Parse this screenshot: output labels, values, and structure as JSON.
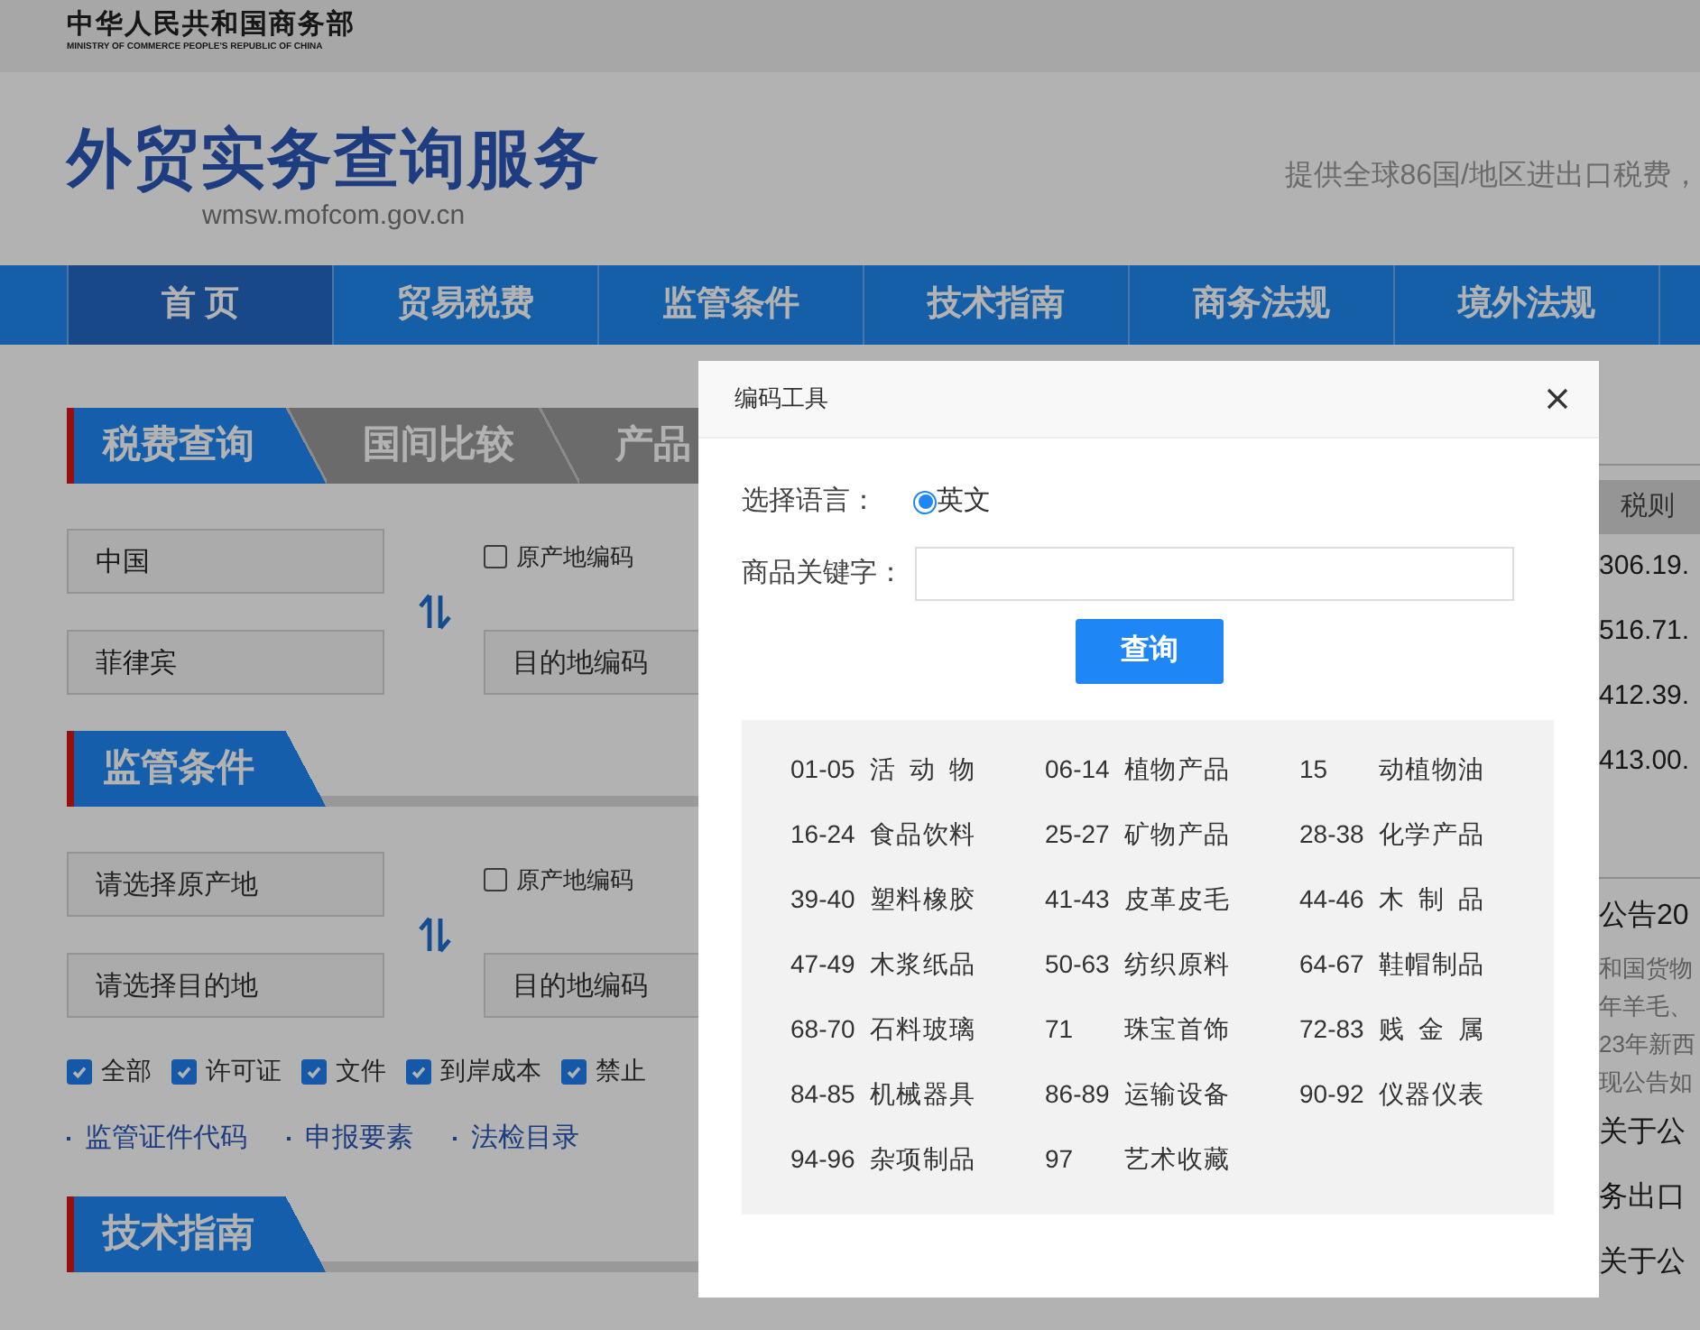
{
  "header": {
    "ministry": "中华人民共和国商务部",
    "ministry_en": "MINISTRY OF COMMERCE PEOPLE'S REPUBLIC OF CHINA",
    "site_title": "外贸实务查询服务",
    "site_url": "wmsw.mofcom.gov.cn",
    "tagline": "提供全球86国/地区进出口税费，"
  },
  "nav": [
    {
      "label": "首 页",
      "selected": true
    },
    {
      "label": "贸易税费",
      "selected": false
    },
    {
      "label": "监管条件",
      "selected": false
    },
    {
      "label": "技术指南",
      "selected": false
    },
    {
      "label": "商务法规",
      "selected": false
    },
    {
      "label": "境外法规",
      "selected": false
    }
  ],
  "tax_section": {
    "tabs": [
      {
        "label": "税费查询",
        "selected": true
      },
      {
        "label": "国间比较",
        "selected": false
      },
      {
        "label": "产品",
        "selected": false
      }
    ],
    "origin": {
      "value": "中国"
    },
    "origin_code": {
      "label": "原产地编码",
      "checked": false
    },
    "destination": {
      "value": "菲律宾"
    },
    "destination_code": {
      "placeholder": "目的地编码"
    }
  },
  "regulatory_section": {
    "title": "监管条件",
    "origin": {
      "placeholder": "请选择原产地"
    },
    "origin_code": {
      "label": "原产地编码",
      "checked": false
    },
    "destination": {
      "placeholder": "请选择目的地"
    },
    "destination_code": {
      "placeholder": "目的地编码"
    },
    "filters": [
      {
        "label": "全部",
        "checked": true
      },
      {
        "label": "许可证",
        "checked": true
      },
      {
        "label": "文件",
        "checked": true
      },
      {
        "label": "到岸成本",
        "checked": true
      },
      {
        "label": "禁止",
        "checked": true
      }
    ],
    "links": [
      "监管证件代码",
      "申报要素",
      "法检目录"
    ]
  },
  "tech_section": {
    "title": "技术指南"
  },
  "right_panel": {
    "column_header": "税则",
    "codes": [
      "306.19.",
      "516.71.",
      "412.39.",
      "413.00."
    ],
    "notice_title": "公告20",
    "notice_lines": [
      "和国货物",
      "年羊毛、",
      "23年新西",
      "现公告如"
    ],
    "news": [
      "关于公",
      "务出口",
      "关于公"
    ]
  },
  "dialog": {
    "title": "编码工具",
    "language_label": "选择语言：",
    "languages": [
      {
        "label": "英文",
        "selected": true
      }
    ],
    "keyword_label": "商品关键字：",
    "search_button": "查询",
    "categories": [
      {
        "code": "01-05",
        "name": "活 动 物"
      },
      {
        "code": "06-14",
        "name": "植物产品"
      },
      {
        "code": "15",
        "name": "动植物油"
      },
      {
        "code": "16-24",
        "name": "食品饮料"
      },
      {
        "code": "25-27",
        "name": "矿物产品"
      },
      {
        "code": "28-38",
        "name": "化学产品"
      },
      {
        "code": "39-40",
        "name": "塑料橡胶"
      },
      {
        "code": "41-43",
        "name": "皮革皮毛"
      },
      {
        "code": "44-46",
        "name": "木 制 品"
      },
      {
        "code": "47-49",
        "name": "木浆纸品"
      },
      {
        "code": "50-63",
        "name": "纺织原料"
      },
      {
        "code": "64-67",
        "name": "鞋帽制品"
      },
      {
        "code": "68-70",
        "name": "石料玻璃"
      },
      {
        "code": "71",
        "name": "珠宝首饰"
      },
      {
        "code": "72-83",
        "name": "贱 金 属"
      },
      {
        "code": "84-85",
        "name": "机械器具"
      },
      {
        "code": "86-89",
        "name": "运输设备"
      },
      {
        "code": "90-92",
        "name": "仪器仪表"
      },
      {
        "code": "94-96",
        "name": "杂项制品"
      },
      {
        "code": "97",
        "name": "艺术收藏"
      }
    ]
  }
}
